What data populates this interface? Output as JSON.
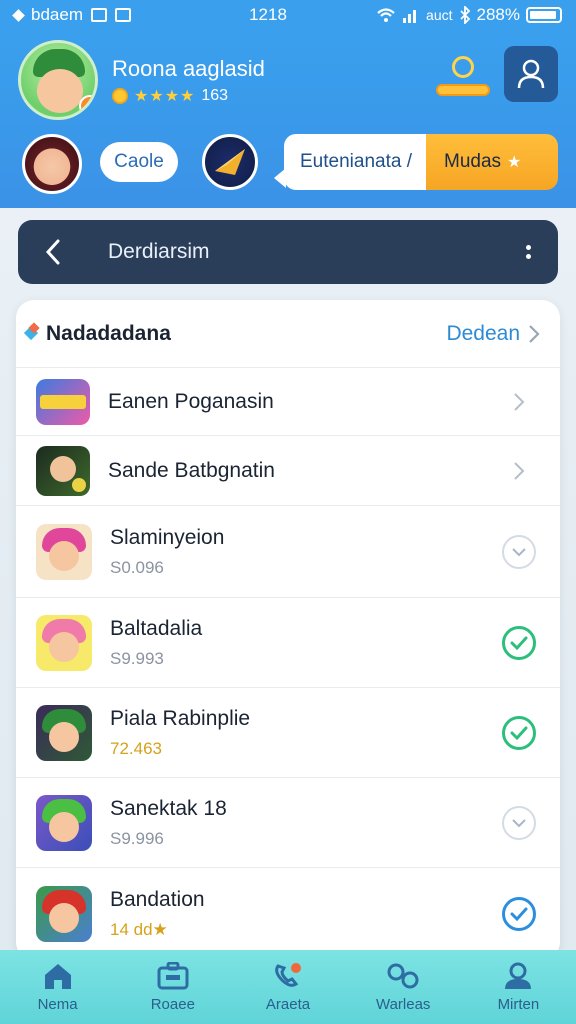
{
  "status_bar": {
    "carrier": "bdaem",
    "time": "1218",
    "network": "auct",
    "battery": "288%"
  },
  "header": {
    "user_name": "Roona aaglasid",
    "rating_stars": "★★★★",
    "rating_value": "163",
    "pill_button": "Caole",
    "bubble_text": "Eutenianata /",
    "bubble_action": "Mudas"
  },
  "nav": {
    "title": "Derdiarsim"
  },
  "list": {
    "header_title": "Nadadadana",
    "header_action": "Dedean",
    "items": [
      {
        "title": "Eanen Poganasin",
        "subtitle": "",
        "status": "chevron"
      },
      {
        "title": "Sande Batbgnatin",
        "subtitle": "",
        "status": "chevron"
      },
      {
        "title": "Slaminyeion",
        "subtitle": "S0.096",
        "status": "unchecked"
      },
      {
        "title": "Baltadalia",
        "subtitle": "S9.993",
        "status": "checked-green"
      },
      {
        "title": "Piala Rabinplie",
        "subtitle": "72.463",
        "status": "checked-green"
      },
      {
        "title": "Sanektak 18",
        "subtitle": "S9.996",
        "status": "unchecked"
      },
      {
        "title": "Bandation",
        "subtitle": "14 dd★",
        "status": "checked-blue"
      }
    ]
  },
  "tabs": [
    {
      "label": "Nema",
      "icon": "home-icon"
    },
    {
      "label": "Roaee",
      "icon": "briefcase-icon"
    },
    {
      "label": "Araeta",
      "icon": "call-icon"
    },
    {
      "label": "Warleas",
      "icon": "link-icon"
    },
    {
      "label": "Mirten",
      "icon": "profile-icon"
    }
  ],
  "colors": {
    "header_blue": "#3aa0ee",
    "nav_dark": "#2a3e5a",
    "accent_orange": "#f6a524",
    "check_green": "#2cbf7c",
    "check_blue": "#2b8fe0",
    "tab_teal": "#6adbdd"
  }
}
